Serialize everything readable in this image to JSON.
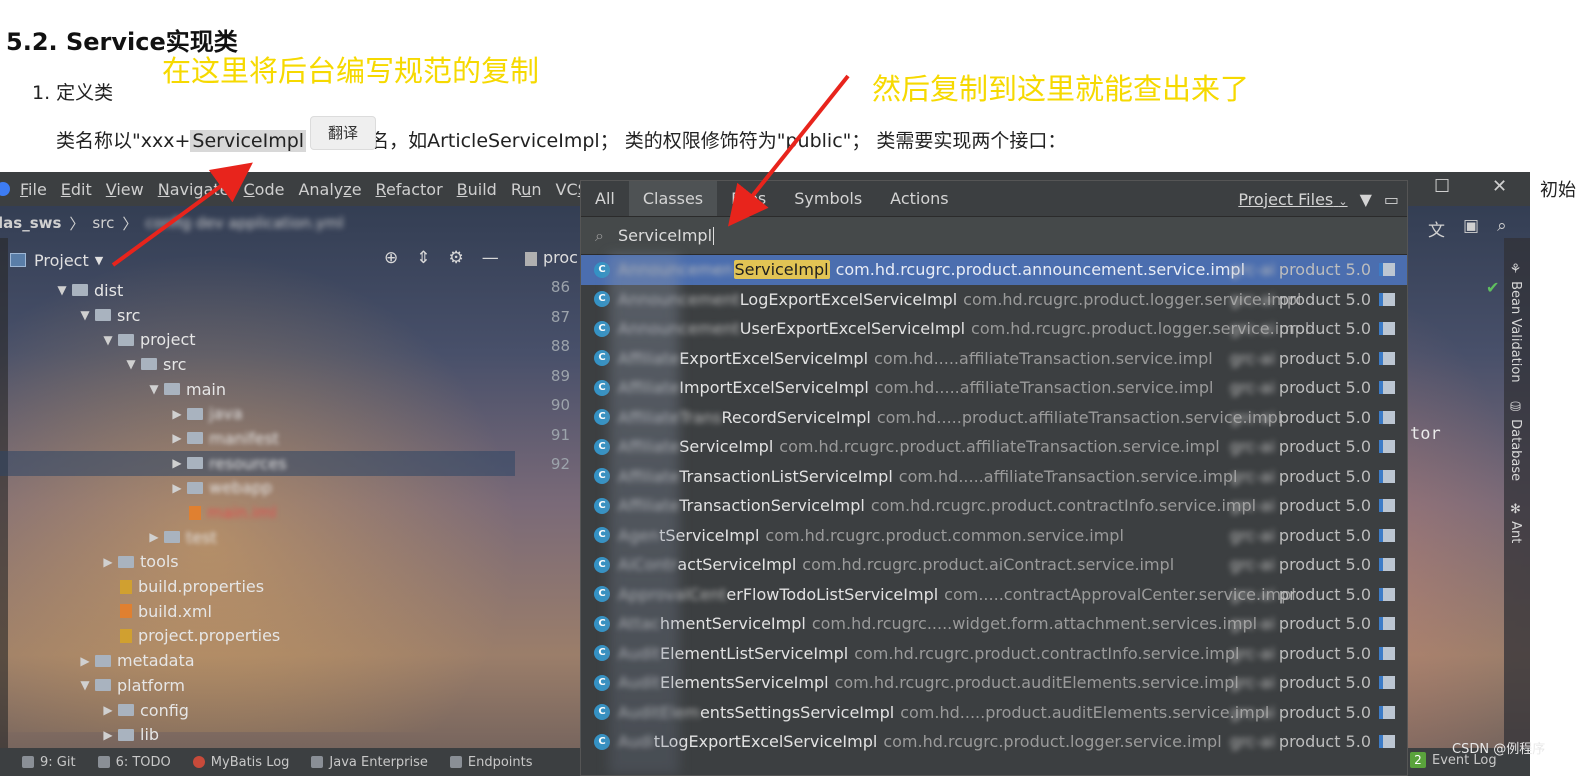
{
  "doc": {
    "heading": "5.2. Service实现类",
    "list_item": "1. 定义类",
    "para_before": "类名称以\"xxx+",
    "para_highlight": "ServiceImpl",
    "para_after": "名，如ArticleServiceImpl；  类的权限修饰符为\"public\"；  类需要实现两个接口：",
    "translate_button": "翻译",
    "right_fragment": "初始",
    "annotation_1": "在这里将后台编写规范的复制",
    "annotation_2": "然后复制到这里就能查出来了"
  },
  "ide": {
    "menu": [
      {
        "pre": "",
        "u": "F",
        "post": "ile"
      },
      {
        "pre": "",
        "u": "E",
        "post": "dit"
      },
      {
        "pre": "",
        "u": "V",
        "post": "iew"
      },
      {
        "pre": "",
        "u": "N",
        "post": "avigate"
      },
      {
        "pre": "",
        "u": "C",
        "post": "ode"
      },
      {
        "pre": "Analy",
        "u": "z",
        "post": "e"
      },
      {
        "pre": "",
        "u": "R",
        "post": "efactor"
      },
      {
        "pre": "",
        "u": "B",
        "post": "uild"
      },
      {
        "pre": "R",
        "u": "u",
        "post": "n"
      },
      {
        "pre": "VC",
        "u": "S",
        "post": ""
      }
    ],
    "breadcrumb_project": "las_sws",
    "breadcrumb_src": "src",
    "breadcrumb_blur": "config  dev  application.yml",
    "project_label": "Project",
    "editor_tab": "proc",
    "editor_fragment": "tor",
    "tree": [
      {
        "indent": 0,
        "arrow": "▼",
        "type": "folder",
        "name": "dist"
      },
      {
        "indent": 1,
        "arrow": "▼",
        "type": "folder",
        "name": "src"
      },
      {
        "indent": 2,
        "arrow": "▼",
        "type": "folder",
        "name": "project"
      },
      {
        "indent": 3,
        "arrow": "▼",
        "type": "folder",
        "name": "src"
      },
      {
        "indent": 4,
        "arrow": "▼",
        "type": "folder",
        "name": "main"
      },
      {
        "indent": 5,
        "arrow": "▶",
        "type": "folder",
        "name": "java",
        "blur": true
      },
      {
        "indent": 5,
        "arrow": "▶",
        "type": "folder",
        "name": "manifest",
        "blur": true
      },
      {
        "indent": 5,
        "arrow": "▶",
        "type": "folder",
        "name": "resources",
        "blur": true,
        "sel": true
      },
      {
        "indent": 5,
        "arrow": "▶",
        "type": "folder",
        "name": "webapp",
        "blur": true
      },
      {
        "indent": 5,
        "arrow": "",
        "type": "xml",
        "name": "main.iml",
        "blur": true,
        "red": true
      },
      {
        "indent": 4,
        "arrow": "▶",
        "type": "folder",
        "name": "test",
        "blur": true
      },
      {
        "indent": 2,
        "arrow": "▶",
        "type": "folder",
        "name": "tools"
      },
      {
        "indent": 2,
        "arrow": "",
        "type": "prop",
        "name": "build.properties"
      },
      {
        "indent": 2,
        "arrow": "",
        "type": "xml",
        "name": "build.xml"
      },
      {
        "indent": 2,
        "arrow": "",
        "type": "prop",
        "name": "project.properties"
      },
      {
        "indent": 1,
        "arrow": "▶",
        "type": "folder",
        "name": "metadata"
      },
      {
        "indent": 1,
        "arrow": "▼",
        "type": "folder",
        "name": "platform"
      },
      {
        "indent": 2,
        "arrow": "▶",
        "type": "folder",
        "name": "config"
      },
      {
        "indent": 2,
        "arrow": "▶",
        "type": "folder",
        "name": "lib"
      }
    ],
    "gutter": [
      "86",
      "87",
      "88",
      "89",
      "90",
      "91",
      "92"
    ],
    "right_panels": [
      "Bean Validation",
      "Database",
      "Ant"
    ],
    "status": [
      {
        "label": "9: Git",
        "icon": "git-icon"
      },
      {
        "label": "6: TODO",
        "icon": "todo-icon"
      },
      {
        "label": "MyBatis Log",
        "icon": "mybatis-icon"
      },
      {
        "label": "Java Enterprise",
        "icon": "java-enterprise-icon"
      },
      {
        "label": "Endpoints",
        "icon": "endpoints-icon"
      }
    ],
    "event_log_count": "2",
    "event_log_label": "Event Log",
    "watermark": "CSDN @例程序"
  },
  "popup": {
    "tabs": [
      "All",
      "Classes",
      "Files",
      "Symbols",
      "Actions"
    ],
    "active_tab": "Classes",
    "filter_label": "Project Files",
    "query": "ServiceImpl",
    "results": [
      {
        "blur": "Announcemen",
        "name_pre": "",
        "match": "ServiceImpl",
        "name_post": "",
        "pkg": "com.hd.rcugrc.product.announcement.service.impl",
        "module": "product 5.0"
      },
      {
        "blur": "Announcement",
        "name_pre": "LogExportExcelServiceImpl",
        "match": "",
        "name_post": "",
        "pkg": "com.hd.rcugrc.product.logger.service.impl",
        "module": "product 5.0"
      },
      {
        "blur": "Announcement",
        "name_pre": "UserExportExcelServiceImpl",
        "match": "",
        "name_post": "",
        "pkg": "com.hd.rcugrc.product.logger.service.impl",
        "module": "product 5.0"
      },
      {
        "blur": "Affiliate",
        "name_pre": "ExportExcelServiceImpl",
        "match": "",
        "name_post": "",
        "pkg": "com.hd.....affiliateTransaction.service.impl",
        "module": "product 5.0"
      },
      {
        "blur": "Affiliate",
        "name_pre": "ImportExcelServiceImpl",
        "match": "",
        "name_post": "",
        "pkg": "com.hd.....affiliateTransaction.service.impl",
        "module": "product 5.0"
      },
      {
        "blur": "AffiliateTrans",
        "name_pre": "RecordServiceImpl",
        "match": "",
        "name_post": "",
        "pkg": "com.hd.....product.affiliateTransaction.service.impl",
        "module": "product 5.0"
      },
      {
        "blur": "Affiliate",
        "name_pre": "ServiceImpl",
        "match": "",
        "name_post": "",
        "pkg": "com.hd.rcugrc.product.affiliateTransaction.service.impl",
        "module": "product 5.0"
      },
      {
        "blur": "Affiliate",
        "name_pre": "TransactionListServiceImpl",
        "match": "",
        "name_post": "",
        "pkg": "com.hd.....affiliateTransaction.service.impl",
        "module": "product 5.0"
      },
      {
        "blur": "Affiliate",
        "name_pre": "TransactionServiceImpl",
        "match": "",
        "name_post": "",
        "pkg": "com.hd.rcugrc.product.contractInfo.service.impl",
        "module": "product 5.0"
      },
      {
        "blur": "Agen",
        "name_pre": "tServiceImpl",
        "match": "",
        "name_post": "",
        "pkg": "com.hd.rcugrc.product.common.service.impl",
        "module": "product 5.0"
      },
      {
        "blur": "AiContr",
        "name_pre": "actServiceImpl",
        "match": "",
        "name_post": "",
        "pkg": "com.hd.rcugrc.product.aiContract.service.impl",
        "module": "product 5.0"
      },
      {
        "blur": "ApprovalCent",
        "name_pre": "erFlowTodoListServiceImpl",
        "match": "",
        "name_post": "",
        "pkg": "com.....contractApprovalCenter.service.impl",
        "module": "product 5.0"
      },
      {
        "blur": "Attac",
        "name_pre": "hmentServiceImpl",
        "match": "",
        "name_post": "",
        "pkg": "com.hd.rcugrc.....widget.form.attachment.services.impl",
        "module": "product 5.0"
      },
      {
        "blur": "Audit",
        "name_pre": "ElementListServiceImpl",
        "match": "",
        "name_post": "",
        "pkg": "com.hd.rcugrc.product.contractInfo.service.impl",
        "module": "product 5.0"
      },
      {
        "blur": "Audit",
        "name_pre": "ElementsServiceImpl",
        "match": "",
        "name_post": "",
        "pkg": "com.hd.rcugrc.product.auditElements.service.impl",
        "module": "product 5.0"
      },
      {
        "blur": "AuditElem",
        "name_pre": "entsSettingsServiceImpl",
        "match": "",
        "name_post": "",
        "pkg": "com.hd.....product.auditElements.service.impl",
        "module": "product 5.0"
      },
      {
        "blur": "Audi",
        "name_pre": "tLogExportExcelServiceImpl",
        "match": "",
        "name_post": "",
        "pkg": "com.hd.rcugrc.product.logger.service.impl",
        "module": "product 5.0"
      }
    ]
  }
}
